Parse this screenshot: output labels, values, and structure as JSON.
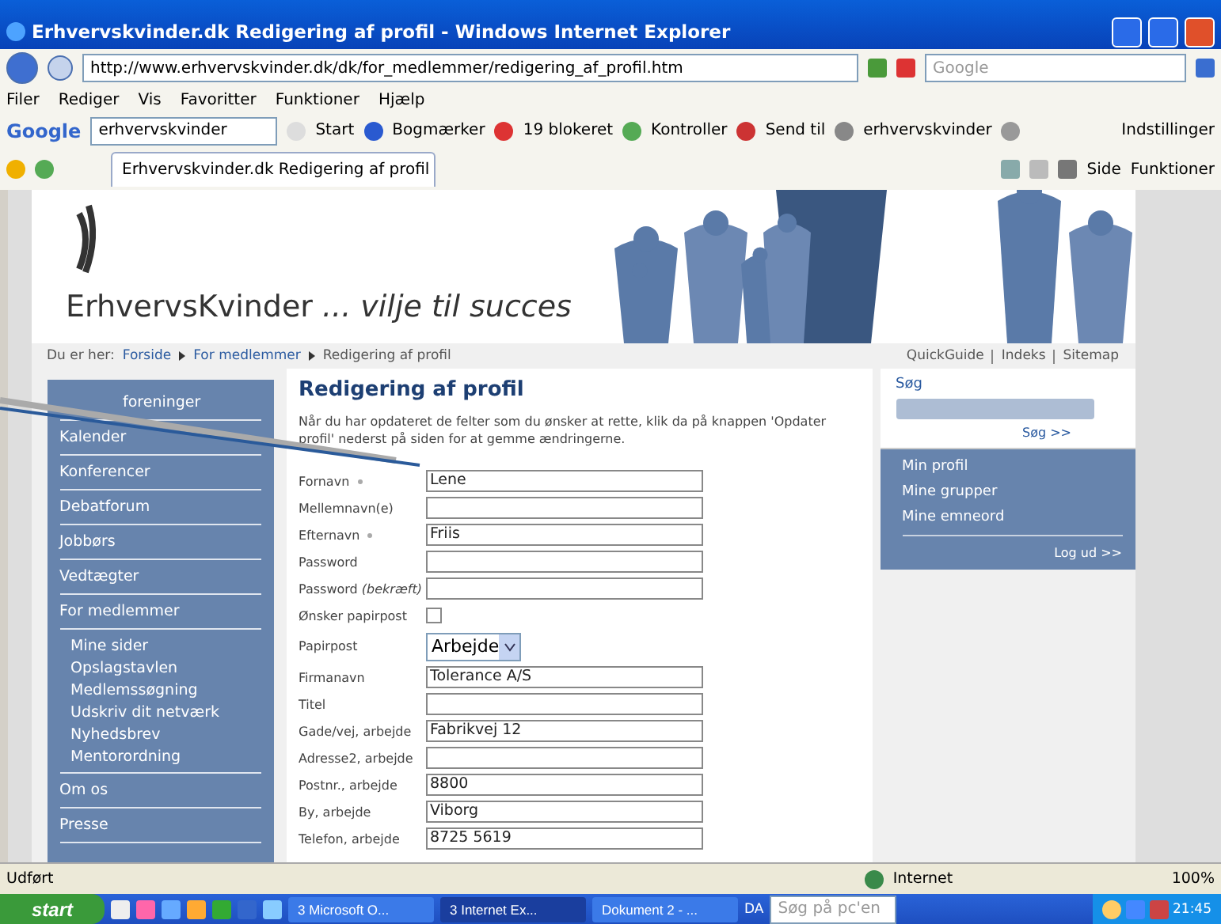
{
  "window": {
    "title": "Erhvervskvinder.dk Redigering af profil - Windows Internet Explorer"
  },
  "address_bar": {
    "url": "http://www.erhvervskvinder.dk/dk/for_medlemmer/redigering_af_profil.htm",
    "search_placeholder": "Google"
  },
  "menu": [
    "Filer",
    "Rediger",
    "Vis",
    "Favoritter",
    "Funktioner",
    "Hjælp"
  ],
  "google_toolbar": {
    "logo": "Google",
    "query": "erhvervskvinder",
    "items": [
      "Start",
      "Bogmærker",
      "19 blokeret",
      "Kontroller",
      "Send til",
      "erhvervskvinder",
      "Indstillinger"
    ]
  },
  "tab": {
    "title": "Erhvervskvinder.dk Redigering af profil"
  },
  "command_bar": [
    "Side",
    "Funktioner"
  ],
  "site": {
    "logo": "ErhvervsKvinder",
    "tagline": "... vilje til succes",
    "breadcrumb": {
      "label": "Du er her:",
      "links": [
        "Forside",
        "For medlemmer"
      ],
      "current": "Redigering af profil"
    },
    "top_links": [
      "QuickGuide",
      "Indeks",
      "Sitemap"
    ],
    "nav": [
      {
        "label": "foreninger"
      },
      {
        "label": "Kalender"
      },
      {
        "label": "Konferencer"
      },
      {
        "label": "Debatforum"
      },
      {
        "label": "Jobbørs"
      },
      {
        "label": "Vedtægter"
      },
      {
        "label": "For medlemmer",
        "children": [
          "Mine sider",
          "Opslagstavlen",
          "Medlemssøgning",
          "Udskriv dit netværk",
          "Nyhedsbrev",
          "Mentorordning"
        ]
      },
      {
        "label": "Om os"
      },
      {
        "label": "Presse"
      }
    ],
    "heading": "Redigering af profil",
    "intro": "Når du har opdateret de felter som du ønsker at rette, klik da på knappen 'Opdater profil' nederst på siden for at gemme ændringerne.",
    "fields": [
      {
        "kind": "text",
        "label": "Fornavn",
        "required": true,
        "value": "Lene"
      },
      {
        "kind": "text",
        "label": "Mellemnavn(e)",
        "required": false
      },
      {
        "kind": "text",
        "label": "Efternavn",
        "required": true,
        "value": "Friis"
      },
      {
        "kind": "text",
        "label": "Password",
        "required": false
      },
      {
        "kind": "text",
        "label": "Password *(bekræft)*",
        "required": false
      },
      {
        "kind": "checkbox",
        "label": "Ønsker papirpost",
        "required": false,
        "checked": false
      },
      {
        "kind": "select",
        "label": "Papirpost",
        "required": false,
        "value": "Arbejde"
      },
      {
        "kind": "text",
        "label": "Firmanavn",
        "required": false,
        "value": "Tolerance A/S"
      },
      {
        "kind": "text",
        "label": "Titel",
        "required": false
      },
      {
        "kind": "text",
        "label": "Gade/vej, arbejde",
        "required": false,
        "value": "Fabrikvej 12"
      },
      {
        "kind": "text",
        "label": "Adresse2, arbejde",
        "required": false
      },
      {
        "kind": "text",
        "label": "Postnr., arbejde",
        "required": false,
        "value": "8800"
      },
      {
        "kind": "text",
        "label": "By, arbejde",
        "required": false,
        "value": "Viborg"
      },
      {
        "kind": "text",
        "label": "Telefon, arbejde",
        "required": false,
        "value": "8725 5619"
      }
    ],
    "search": {
      "title": "Søg",
      "button": "Søg >>"
    },
    "member_links": [
      "Min profil",
      "Mine grupper",
      "Mine emneord"
    ],
    "logout": "Log ud >>"
  },
  "status_bar": {
    "text": "Udført",
    "zone": "Internet",
    "zoom": "100%"
  },
  "taskbar": {
    "start": "start",
    "tasks": [
      "3 Microsoft O...",
      "3 Internet Ex...",
      "Dokument 2 - ..."
    ],
    "language": "DA",
    "search_placeholder": "Søg på pc'en",
    "clock": "21:45"
  }
}
